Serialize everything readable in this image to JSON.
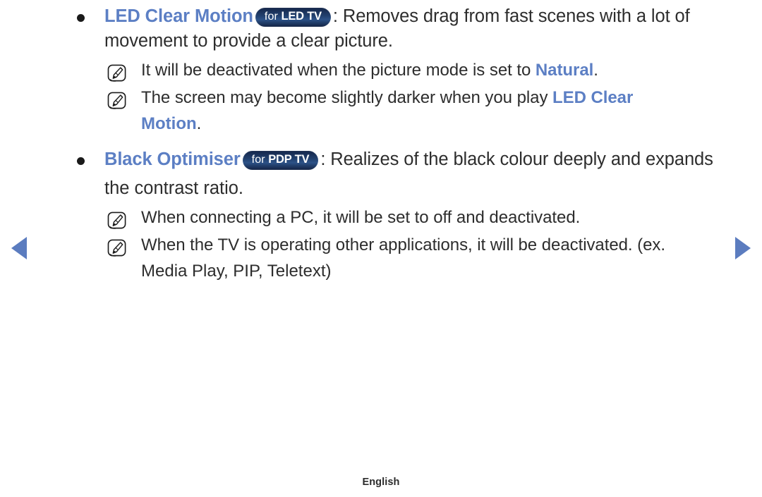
{
  "page": {
    "footer_language": "English"
  },
  "nav": {
    "prev_label": "previous-page",
    "next_label": "next-page",
    "prev_icon": "triangle-left-icon",
    "next_icon": "triangle-right-icon",
    "arrow_color": "#5b7cbf"
  },
  "colors": {
    "keyword_blue": "#5c7fc4",
    "body_text": "#2d2d2d",
    "badge_navy": "#14264a",
    "badge_navy_light": "#2c5287"
  },
  "sections": [
    {
      "id": "led-clear-motion",
      "bullet_icon": "bullet-dot",
      "title": "LED Clear Motion",
      "badge": {
        "prefix": "for",
        "model": "LED TV"
      },
      "body": ": Removes drag from fast scenes with a lot of movement to provide a clear picture.",
      "notes": [
        {
          "icon": "note-pencil-icon",
          "segments": [
            {
              "text": "It will be deactivated when the picture mode is set to ",
              "style": "normal"
            },
            {
              "text": "Natural",
              "style": "keyword"
            },
            {
              "text": ".",
              "style": "normal"
            }
          ]
        },
        {
          "icon": "note-pencil-icon",
          "segments": [
            {
              "text": "The screen may become slightly darker when you play ",
              "style": "normal"
            },
            {
              "text": "LED Clear Motion",
              "style": "keyword"
            },
            {
              "text": ".",
              "style": "normal"
            }
          ]
        }
      ]
    },
    {
      "id": "black-optimiser",
      "bullet_icon": "bullet-dot",
      "title": "Black Optimiser",
      "badge": {
        "prefix": "for",
        "model": "PDP TV"
      },
      "body": ": Realizes of the black colour deeply and expands the contrast ratio.",
      "notes": [
        {
          "icon": "note-pencil-icon",
          "segments": [
            {
              "text": "When connecting a PC, it will be set to off and deactivated.",
              "style": "normal"
            }
          ]
        },
        {
          "icon": "note-pencil-icon",
          "segments": [
            {
              "text": "When the TV is operating other applications, it will be deactivated. (ex. Media Play, PIP, Teletext)",
              "style": "normal"
            }
          ]
        }
      ]
    }
  ],
  "text": {
    "s1_title": "LED Clear Motion",
    "s1_badge_for": "for",
    "s1_badge_model": "LED TV",
    "s1_body_a": ": Removes drag from fast scenes with a lot of",
    "s1_body_b": "movement to provide a clear picture.",
    "s1_note1_a": "It will be deactivated when the picture mode is set to ",
    "s1_note1_kw": "Natural",
    "s1_note1_b": ".",
    "s1_note2_a": "The screen may become slightly darker when you play ",
    "s1_note2_kw": "LED Clear",
    "s1_note2_kw2": "Motion",
    "s1_note2_b": ".",
    "s2_title": "Black Optimiser",
    "s2_badge_for": "for",
    "s2_badge_model": "PDP TV",
    "s2_body_a": ": Realizes of the black colour deeply and expands",
    "s2_body_b": "the contrast ratio.",
    "s2_note1": "When connecting a PC, it will be set to off and deactivated.",
    "s2_note2_a": "When the TV is operating other applications, it will be deactivated. (ex.",
    "s2_note2_b": "Media Play, PIP, Teletext)"
  }
}
